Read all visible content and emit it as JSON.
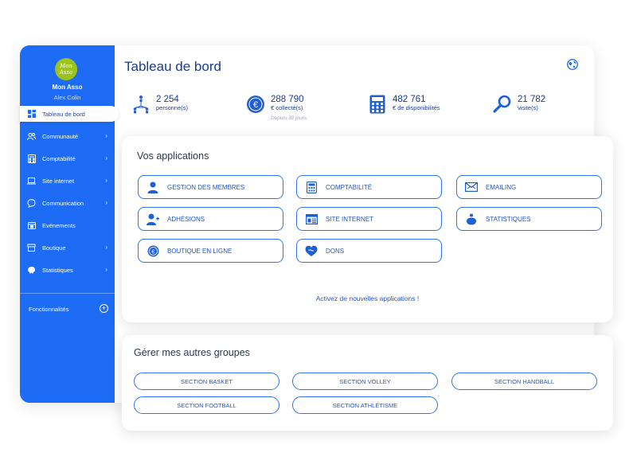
{
  "sidebar": {
    "logo_text": "Mon Asso",
    "org_name": "Mon Asso",
    "user_name": "Alex Colin",
    "items": [
      {
        "label": "Tableau de bord",
        "icon": "dashboard-icon"
      },
      {
        "label": "Communauté",
        "icon": "community-icon"
      },
      {
        "label": "Comptabilité",
        "icon": "calculator-icon"
      },
      {
        "label": "Site internet",
        "icon": "laptop-icon"
      },
      {
        "label": "Communication",
        "icon": "chat-icon"
      },
      {
        "label": "Evénements",
        "icon": "calendar-icon"
      },
      {
        "label": "Boutique",
        "icon": "shop-icon"
      },
      {
        "label": "Statistiques",
        "icon": "piggy-bank-icon"
      }
    ],
    "features_label": "Fonctionnalités",
    "features_icon": "plus-circle-icon"
  },
  "header": {
    "title": "Tableau de bord",
    "globe_icon": "globe-icon"
  },
  "stats": [
    {
      "value": "2 254",
      "label": "personne(s)",
      "sub": "",
      "icon": "people-network-icon"
    },
    {
      "value": "288 790",
      "label": "€ collecté(s)",
      "sub": "Depuis 30 jours",
      "icon": "euro-coin-icon"
    },
    {
      "value": "482 761",
      "label": "€ de disponibilités",
      "sub": "",
      "icon": "calculator-icon"
    },
    {
      "value": "21 782",
      "label": "visite(s)",
      "sub": "",
      "icon": "magnifier-icon"
    }
  ],
  "apps": {
    "title": "Vos applications",
    "items": [
      {
        "label": "GESTION DES MEMBRES",
        "icon": "member-icon"
      },
      {
        "label": "COMPTABILITÉ",
        "icon": "calculator-icon"
      },
      {
        "label": "EMAILING",
        "icon": "envelope-icon"
      },
      {
        "label": "ADHÉSIONS",
        "icon": "add-member-icon"
      },
      {
        "label": "SITE INTERNET",
        "icon": "website-icon"
      },
      {
        "label": "STATISTIQUES",
        "icon": "piggy-bank-icon"
      },
      {
        "label": "BOUTIQUE EN LIGNE",
        "icon": "euro-coin-icon"
      },
      {
        "label": "DONS",
        "icon": "heart-hand-icon"
      }
    ],
    "activate_link": "Activez de nouvelles applications !"
  },
  "groups": {
    "title": "Gérer mes autres groupes",
    "items": [
      {
        "label": "SECTION BASKET"
      },
      {
        "label": "SECTION VOLLEY"
      },
      {
        "label": "SECTION HANDBALL"
      },
      {
        "label": "SECTION FOOTBALL"
      },
      {
        "label": "SECTION ATHLÉTISME"
      }
    ]
  },
  "colors": {
    "sidebar": "#1e6cf6",
    "accent": "#2f74f0",
    "title": "#1a3d8f",
    "logo": "#9bc31c"
  }
}
